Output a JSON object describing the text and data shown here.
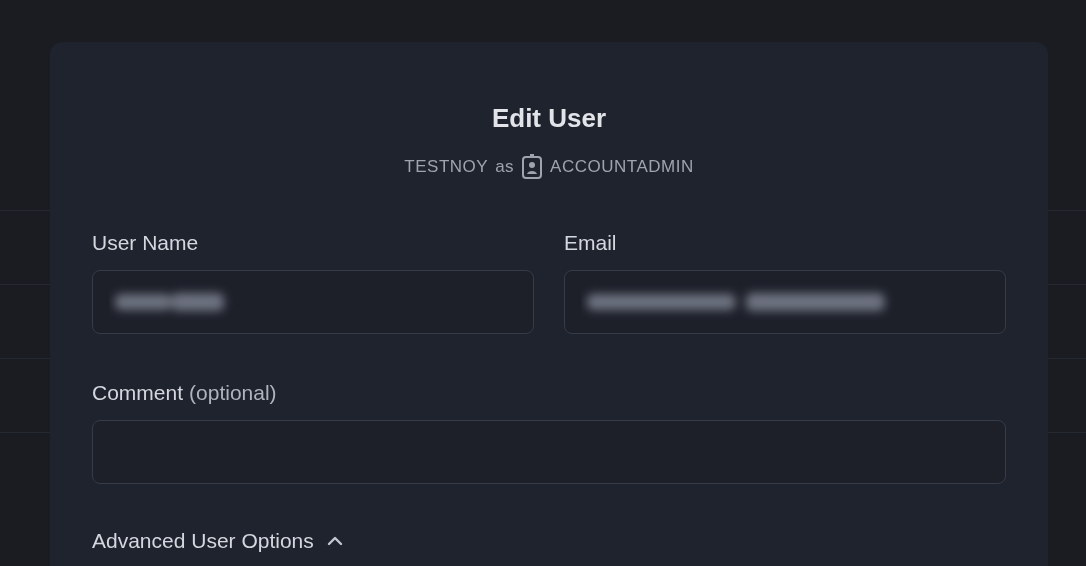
{
  "dialog": {
    "title": "Edit User",
    "context": {
      "user": "TESTNOY",
      "connector": "as",
      "role": "ACCOUNTADMIN"
    }
  },
  "fields": [
    {
      "label": "User Name",
      "kind": "blurred"
    },
    {
      "label": "Email",
      "kind": "blurred"
    },
    {
      "label": "Comment",
      "hint": "(optional)",
      "kind": "empty"
    }
  ],
  "advanced_options": {
    "label": "Advanced User Options",
    "expanded": true
  }
}
